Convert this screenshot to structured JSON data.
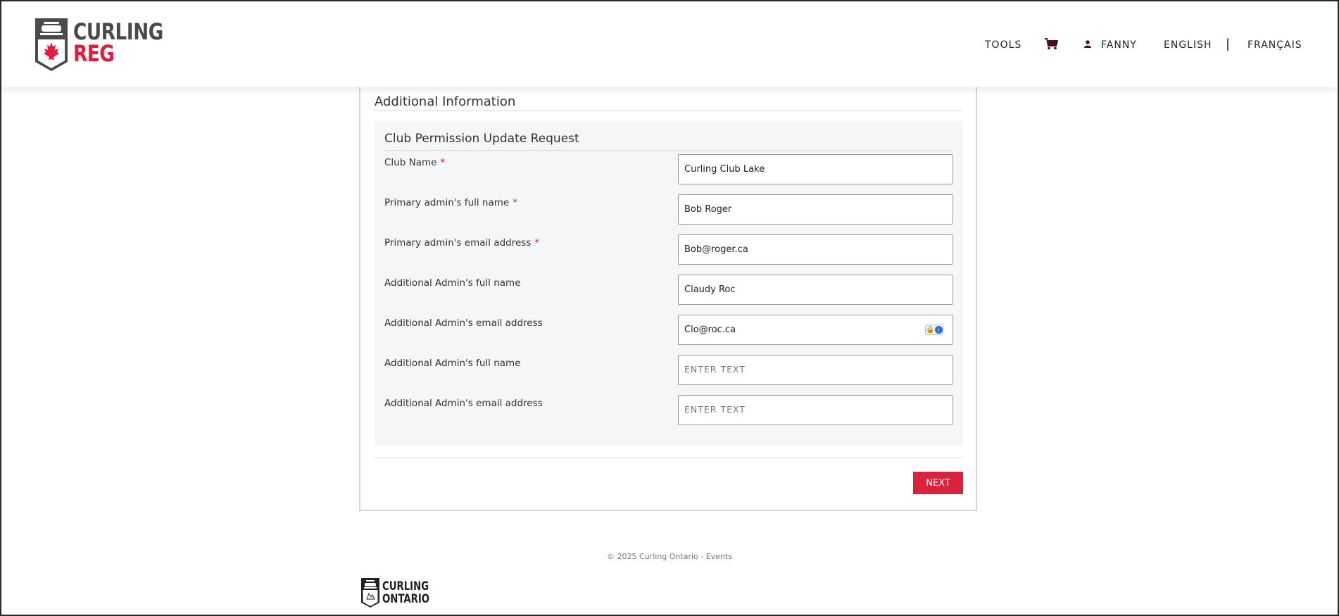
{
  "header": {
    "logo": {
      "line1": "CURLING",
      "line2": "REG"
    },
    "nav": {
      "tools": "TOOLS",
      "cart_icon": "shopping-cart-icon",
      "user_icon": "user-icon",
      "user": "FANNY",
      "english": "ENGLISH",
      "separator": "|",
      "french": "FRANÇAIS"
    }
  },
  "main": {
    "section_title": "Additional Information",
    "panel": {
      "title": "Club Permission Update Request",
      "fields": [
        {
          "label": "Club Name",
          "required": "*",
          "value": "Curling Club Lake",
          "placeholder": ""
        },
        {
          "label": "Primary admin's full name",
          "required": "*",
          "value": "Bob Roger",
          "placeholder": ""
        },
        {
          "label": "Primary admin's email address",
          "required": "*",
          "value": "Bob@roger.ca",
          "placeholder": ""
        },
        {
          "label": "Additional Admin's full name",
          "value": "Claudy Roc",
          "placeholder": ""
        },
        {
          "label": "Additional Admin's email address",
          "value": "Clo@roc.ca",
          "placeholder": ""
        },
        {
          "label": "Additional Admin's full name",
          "value": "",
          "placeholder": "ENTER TEXT"
        },
        {
          "label": "Additional Admin's email address",
          "value": "",
          "placeholder": "ENTER TEXT"
        }
      ]
    },
    "next_label": "NEXT"
  },
  "footer": {
    "copyright": "© 2025 Curling Ontario - Events",
    "logo": {
      "line1": "CURLING",
      "line2": "ONTARIO"
    }
  },
  "colors": {
    "brand_red": "#d9233b",
    "logo_red": "#e11d3b",
    "panel_bg": "#f4f6f8"
  }
}
